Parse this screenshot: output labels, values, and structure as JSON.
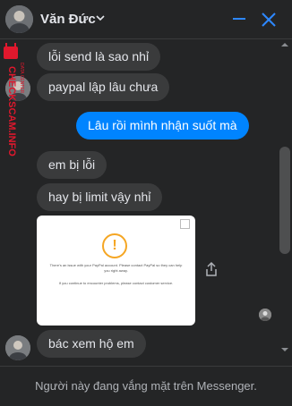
{
  "header": {
    "contact_name": "Văn Đức"
  },
  "messages": [
    {
      "side": "in",
      "text": "lỗi send là sao nhỉ"
    },
    {
      "side": "in",
      "text": "paypal lập lâu chưa"
    },
    {
      "side": "out",
      "text": "Lâu rồi mình nhận suốt mà"
    },
    {
      "side": "in",
      "text": "em bị lỗi"
    },
    {
      "side": "in",
      "text": "hay bị limit vậy nhỉ"
    },
    {
      "side": "in",
      "text": "bác xem hộ em"
    }
  ],
  "attachment": {
    "line1": "There's an issue with your PayPal account. Please contact PayPal so they can help you right away.",
    "line2": "If you continue to encounter problems, please contact customer service."
  },
  "watermark": {
    "line1": "DATA CENTER",
    "line2": "CHECKSCAM.INFO"
  },
  "footer": {
    "status_text": "Người này đang vắng mặt trên Messenger."
  },
  "colors": {
    "background": "#242526",
    "incoming_bubble": "#3a3b3c",
    "outgoing_bubble": "#0084ff",
    "accent": "#2d88ff",
    "watermark": "#e0182d"
  }
}
